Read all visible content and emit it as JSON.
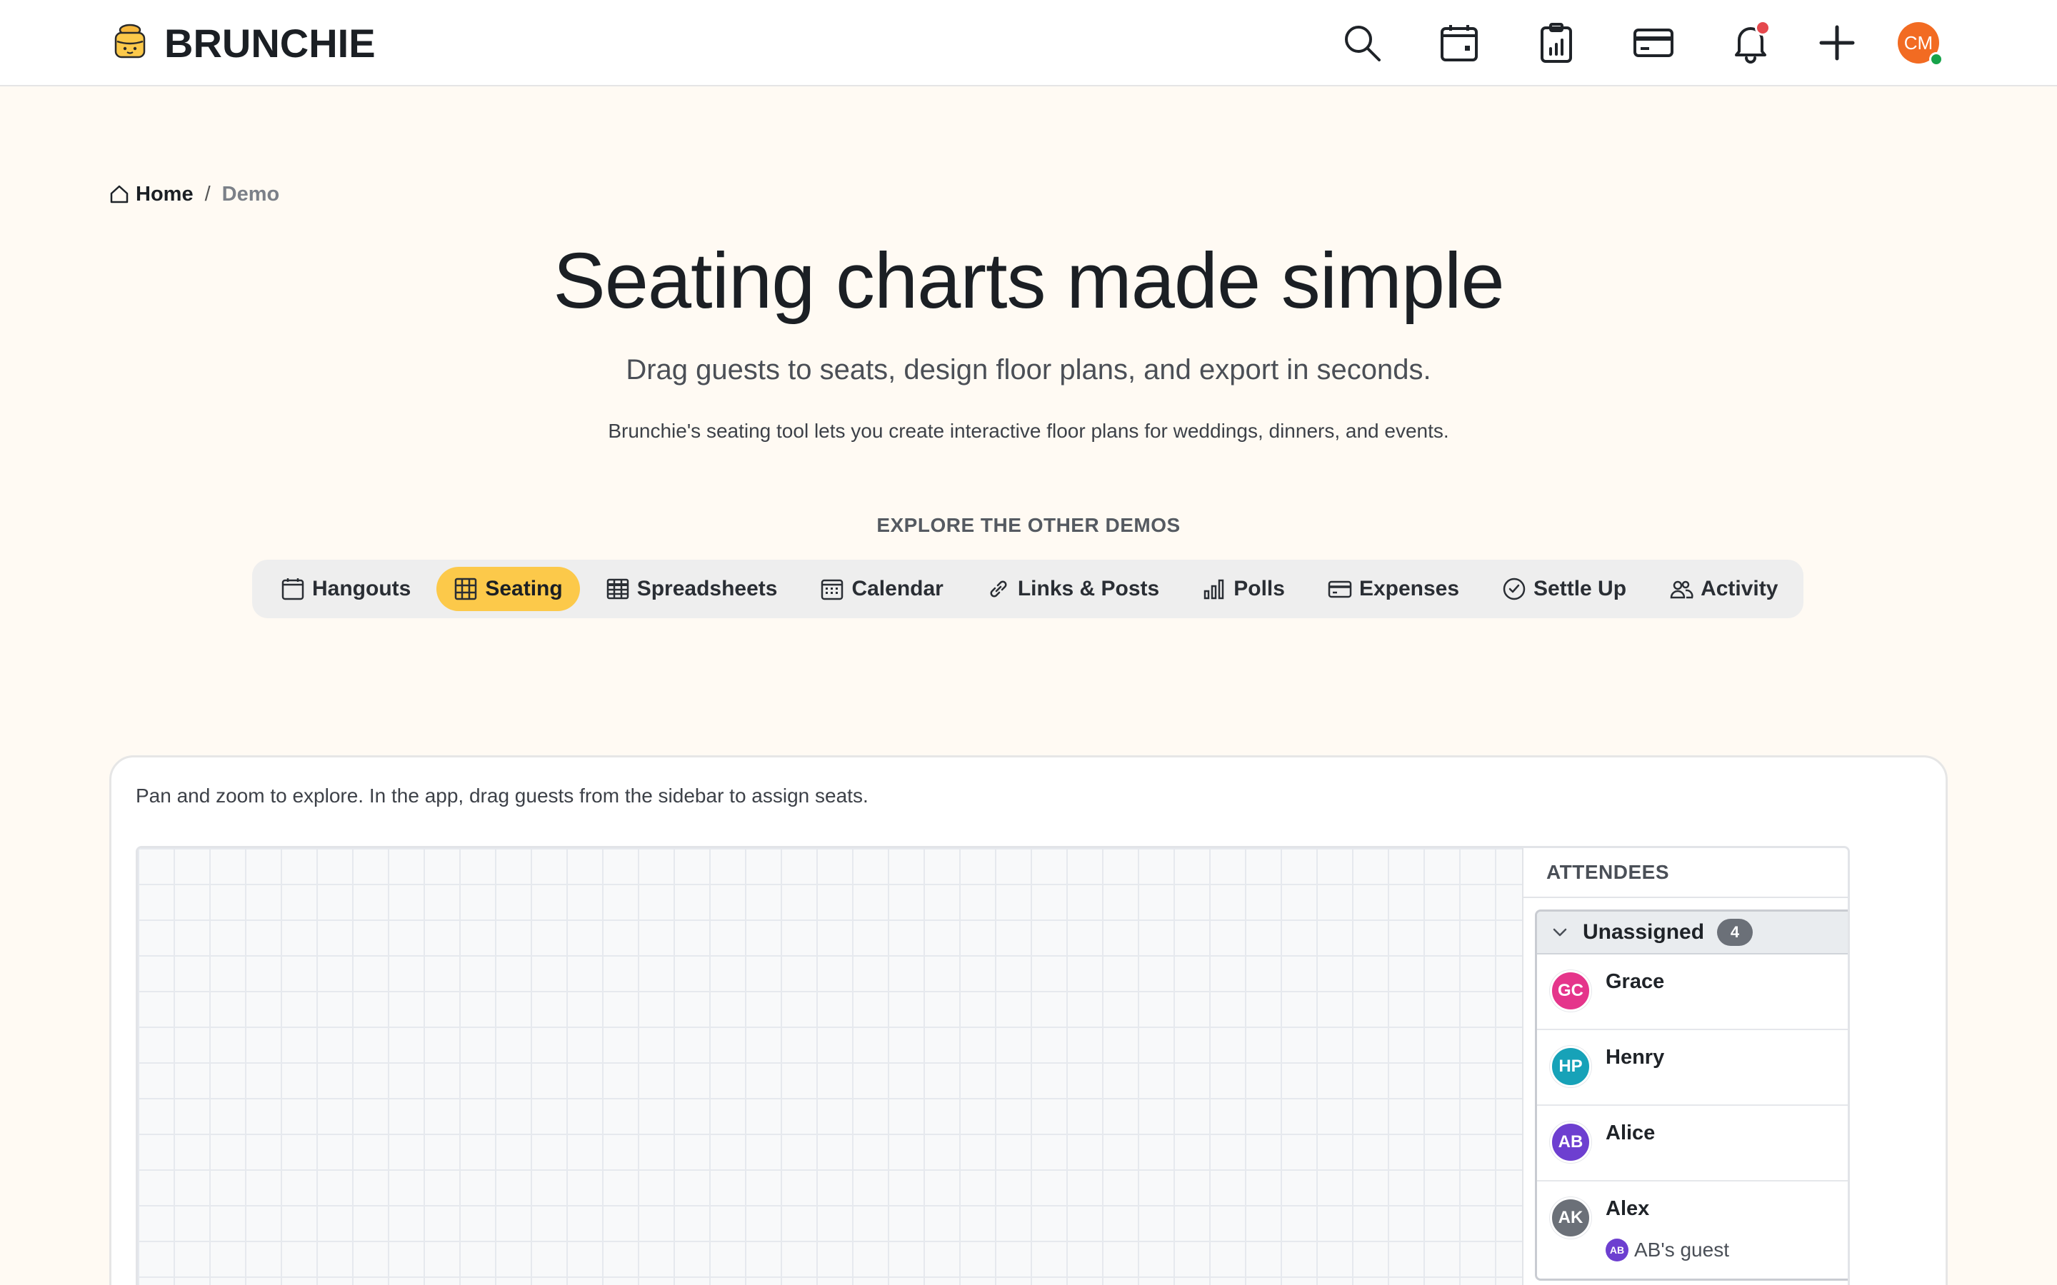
{
  "brand": {
    "name": "BRUNCHIE",
    "logo_icon": "brunch-cake-icon",
    "accent": "#fcc94a"
  },
  "topnav": {
    "icons": [
      "search-icon",
      "calendar-icon",
      "clipboard-chart-icon",
      "credit-card-icon",
      "bell-icon",
      "plus-icon"
    ],
    "notification_color": "#e5484d",
    "user": {
      "initials": "CM",
      "color": "#f26b22",
      "status": "online"
    }
  },
  "breadcrumb": {
    "home": "Home",
    "separator": "/",
    "current": "Demo"
  },
  "hero": {
    "title": "Seating charts made simple",
    "subtitle": "Drag guests to seats, design floor plans, and export in seconds.",
    "description": "Brunchie's seating tool lets you create interactive floor plans for weddings, dinners, and events."
  },
  "explore": {
    "label": "EXPLORE THE OTHER DEMOS",
    "tabs": [
      {
        "label": "Hangouts",
        "icon": "calendar-icon"
      },
      {
        "label": "Seating",
        "icon": "grid-icon",
        "active": true
      },
      {
        "label": "Spreadsheets",
        "icon": "table-icon"
      },
      {
        "label": "Calendar",
        "icon": "calendar-grid-icon"
      },
      {
        "label": "Links & Posts",
        "icon": "link-icon"
      },
      {
        "label": "Polls",
        "icon": "bar-chart-icon"
      },
      {
        "label": "Expenses",
        "icon": "credit-card-icon"
      },
      {
        "label": "Settle Up",
        "icon": "check-circle-icon"
      },
      {
        "label": "Activity",
        "icon": "users-icon"
      }
    ]
  },
  "demo": {
    "hint": "Pan and zoom to explore. In the app, drag guests from the sidebar to assign seats.",
    "sidebar": {
      "title": "ATTENDEES",
      "group": {
        "title": "Unassigned",
        "count": "4",
        "attendees": [
          {
            "initials": "GC",
            "name": "Grace",
            "color": "#e5358b"
          },
          {
            "initials": "HP",
            "name": "Henry",
            "color": "#17a2b8"
          },
          {
            "initials": "AB",
            "name": "Alice",
            "color": "#6d3fd0"
          },
          {
            "initials": "AK",
            "name": "Alex",
            "color": "#6b7078",
            "guest_of_initials": "AB",
            "guest_of": "AB's guest"
          }
        ]
      }
    }
  }
}
